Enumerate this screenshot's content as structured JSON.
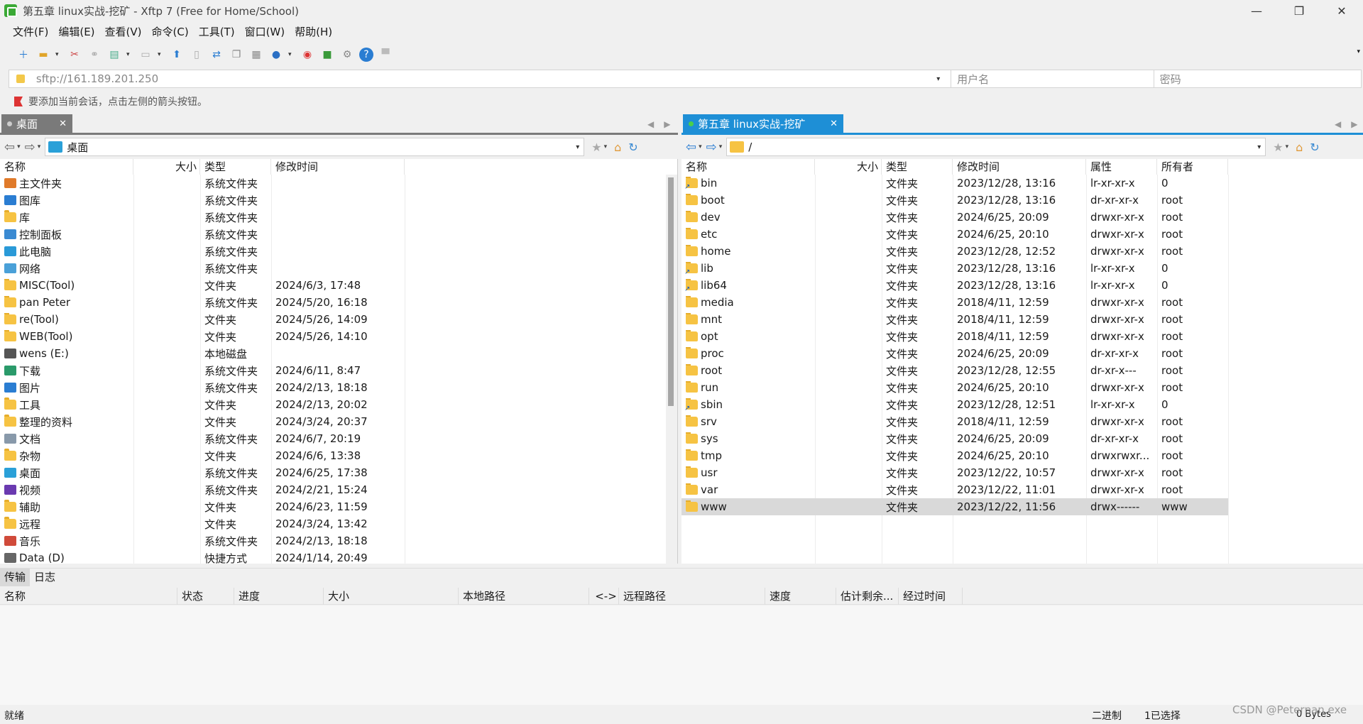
{
  "window": {
    "title": "第五章 linux实战-挖矿 - Xftp 7 (Free for Home/School)",
    "min": "—",
    "max": "❐",
    "close": "✕"
  },
  "menu": [
    "文件(F)",
    "编辑(E)",
    "查看(V)",
    "命令(C)",
    "工具(T)",
    "窗口(W)",
    "帮助(H)"
  ],
  "address": {
    "host": "sftp://161.189.201.250",
    "username_placeholder": "用户名",
    "password_placeholder": "密码"
  },
  "info": "要添加当前会话，点击左侧的箭头按钮。",
  "left_panel": {
    "tab_label": "桌面",
    "path": "桌面",
    "columns": [
      "名称",
      "大小",
      "类型",
      "修改时间"
    ],
    "rows": [
      {
        "name": "主文件夹",
        "size": "",
        "type": "系统文件夹",
        "date": "",
        "icon": "home-icon"
      },
      {
        "name": "图库",
        "size": "",
        "type": "系统文件夹",
        "date": "",
        "icon": "gallery-icon"
      },
      {
        "name": "库",
        "size": "",
        "type": "系统文件夹",
        "date": "",
        "icon": "folder-icon"
      },
      {
        "name": "控制面板",
        "size": "",
        "type": "系统文件夹",
        "date": "",
        "icon": "control-panel-icon"
      },
      {
        "name": "此电脑",
        "size": "",
        "type": "系统文件夹",
        "date": "",
        "icon": "computer-icon"
      },
      {
        "name": "网络",
        "size": "",
        "type": "系统文件夹",
        "date": "",
        "icon": "network-icon"
      },
      {
        "name": "MISC(Tool)",
        "size": "",
        "type": "文件夹",
        "date": "2024/6/3, 17:48",
        "icon": "folder-icon"
      },
      {
        "name": "pan Peter",
        "size": "",
        "type": "系统文件夹",
        "date": "2024/5/20, 16:18",
        "icon": "folder-icon"
      },
      {
        "name": "re(Tool)",
        "size": "",
        "type": "文件夹",
        "date": "2024/5/26, 14:09",
        "icon": "folder-icon"
      },
      {
        "name": "WEB(Tool)",
        "size": "",
        "type": "文件夹",
        "date": "2024/5/26, 14:10",
        "icon": "folder-icon"
      },
      {
        "name": "wens (E:)",
        "size": "",
        "type": "本地磁盘",
        "date": "",
        "icon": "drive-icon"
      },
      {
        "name": "下载",
        "size": "",
        "type": "系统文件夹",
        "date": "2024/6/11, 8:47",
        "icon": "download-icon"
      },
      {
        "name": "图片",
        "size": "",
        "type": "系统文件夹",
        "date": "2024/2/13, 18:18",
        "icon": "pictures-icon"
      },
      {
        "name": "工具",
        "size": "",
        "type": "文件夹",
        "date": "2024/2/13, 20:02",
        "icon": "folder-icon"
      },
      {
        "name": "整理的资料",
        "size": "",
        "type": "文件夹",
        "date": "2024/3/24, 20:37",
        "icon": "folder-icon"
      },
      {
        "name": "文档",
        "size": "",
        "type": "系统文件夹",
        "date": "2024/6/7, 20:19",
        "icon": "documents-icon"
      },
      {
        "name": "杂物",
        "size": "",
        "type": "文件夹",
        "date": "2024/6/6, 13:38",
        "icon": "folder-icon"
      },
      {
        "name": "桌面",
        "size": "",
        "type": "系统文件夹",
        "date": "2024/6/25, 17:38",
        "icon": "desktop-icon"
      },
      {
        "name": "视频",
        "size": "",
        "type": "系统文件夹",
        "date": "2024/2/21, 15:24",
        "icon": "video-icon"
      },
      {
        "name": "辅助",
        "size": "",
        "type": "文件夹",
        "date": "2024/6/23, 11:59",
        "icon": "folder-icon"
      },
      {
        "name": "远程",
        "size": "",
        "type": "文件夹",
        "date": "2024/3/24, 13:42",
        "icon": "folder-icon"
      },
      {
        "name": "音乐",
        "size": "",
        "type": "系统文件夹",
        "date": "2024/2/13, 18:18",
        "icon": "music-icon"
      },
      {
        "name": "Data (D)",
        "size": "",
        "type": "快捷方式",
        "date": "2024/1/14, 20:49",
        "icon": "shortcut-icon"
      }
    ]
  },
  "right_panel": {
    "tab_label": "第五章 linux实战-挖矿",
    "path": "/",
    "columns": [
      "名称",
      "大小",
      "类型",
      "修改时间",
      "属性",
      "所有者"
    ],
    "rows": [
      {
        "name": "bin",
        "size": "",
        "type": "文件夹",
        "date": "2023/12/28, 13:16",
        "perm": "lr-xr-xr-x",
        "owner": "0",
        "link": true
      },
      {
        "name": "boot",
        "size": "",
        "type": "文件夹",
        "date": "2023/12/28, 13:16",
        "perm": "dr-xr-xr-x",
        "owner": "root",
        "link": false
      },
      {
        "name": "dev",
        "size": "",
        "type": "文件夹",
        "date": "2024/6/25, 20:09",
        "perm": "drwxr-xr-x",
        "owner": "root",
        "link": false
      },
      {
        "name": "etc",
        "size": "",
        "type": "文件夹",
        "date": "2024/6/25, 20:10",
        "perm": "drwxr-xr-x",
        "owner": "root",
        "link": false
      },
      {
        "name": "home",
        "size": "",
        "type": "文件夹",
        "date": "2023/12/28, 12:52",
        "perm": "drwxr-xr-x",
        "owner": "root",
        "link": false
      },
      {
        "name": "lib",
        "size": "",
        "type": "文件夹",
        "date": "2023/12/28, 13:16",
        "perm": "lr-xr-xr-x",
        "owner": "0",
        "link": true
      },
      {
        "name": "lib64",
        "size": "",
        "type": "文件夹",
        "date": "2023/12/28, 13:16",
        "perm": "lr-xr-xr-x",
        "owner": "0",
        "link": true
      },
      {
        "name": "media",
        "size": "",
        "type": "文件夹",
        "date": "2018/4/11, 12:59",
        "perm": "drwxr-xr-x",
        "owner": "root",
        "link": false
      },
      {
        "name": "mnt",
        "size": "",
        "type": "文件夹",
        "date": "2018/4/11, 12:59",
        "perm": "drwxr-xr-x",
        "owner": "root",
        "link": false
      },
      {
        "name": "opt",
        "size": "",
        "type": "文件夹",
        "date": "2018/4/11, 12:59",
        "perm": "drwxr-xr-x",
        "owner": "root",
        "link": false
      },
      {
        "name": "proc",
        "size": "",
        "type": "文件夹",
        "date": "2024/6/25, 20:09",
        "perm": "dr-xr-xr-x",
        "owner": "root",
        "link": false
      },
      {
        "name": "root",
        "size": "",
        "type": "文件夹",
        "date": "2023/12/28, 12:55",
        "perm": "dr-xr-x---",
        "owner": "root",
        "link": false
      },
      {
        "name": "run",
        "size": "",
        "type": "文件夹",
        "date": "2024/6/25, 20:10",
        "perm": "drwxr-xr-x",
        "owner": "root",
        "link": false
      },
      {
        "name": "sbin",
        "size": "",
        "type": "文件夹",
        "date": "2023/12/28, 12:51",
        "perm": "lr-xr-xr-x",
        "owner": "0",
        "link": true
      },
      {
        "name": "srv",
        "size": "",
        "type": "文件夹",
        "date": "2018/4/11, 12:59",
        "perm": "drwxr-xr-x",
        "owner": "root",
        "link": false
      },
      {
        "name": "sys",
        "size": "",
        "type": "文件夹",
        "date": "2024/6/25, 20:09",
        "perm": "dr-xr-xr-x",
        "owner": "root",
        "link": false
      },
      {
        "name": "tmp",
        "size": "",
        "type": "文件夹",
        "date": "2024/6/25, 20:10",
        "perm": "drwxrwxr...",
        "owner": "root",
        "link": false
      },
      {
        "name": "usr",
        "size": "",
        "type": "文件夹",
        "date": "2023/12/22, 10:57",
        "perm": "drwxr-xr-x",
        "owner": "root",
        "link": false
      },
      {
        "name": "var",
        "size": "",
        "type": "文件夹",
        "date": "2023/12/22, 11:01",
        "perm": "drwxr-xr-x",
        "owner": "root",
        "link": false
      },
      {
        "name": "www",
        "size": "",
        "type": "文件夹",
        "date": "2023/12/22, 11:56",
        "perm": "drwx------",
        "owner": "www",
        "link": false,
        "selected": true
      }
    ]
  },
  "bottom_tabs": [
    "传输",
    "日志"
  ],
  "transfer_columns": [
    "名称",
    "状态",
    "进度",
    "大小",
    "本地路径",
    "<->",
    "远程路径",
    "速度",
    "估计剩余...",
    "经过时间"
  ],
  "status": {
    "left": "就绪",
    "mode": "二进制",
    "selection": "1已选择",
    "size": "0 Bytes",
    "watermark": "CSDN @Peterpan.exe"
  }
}
